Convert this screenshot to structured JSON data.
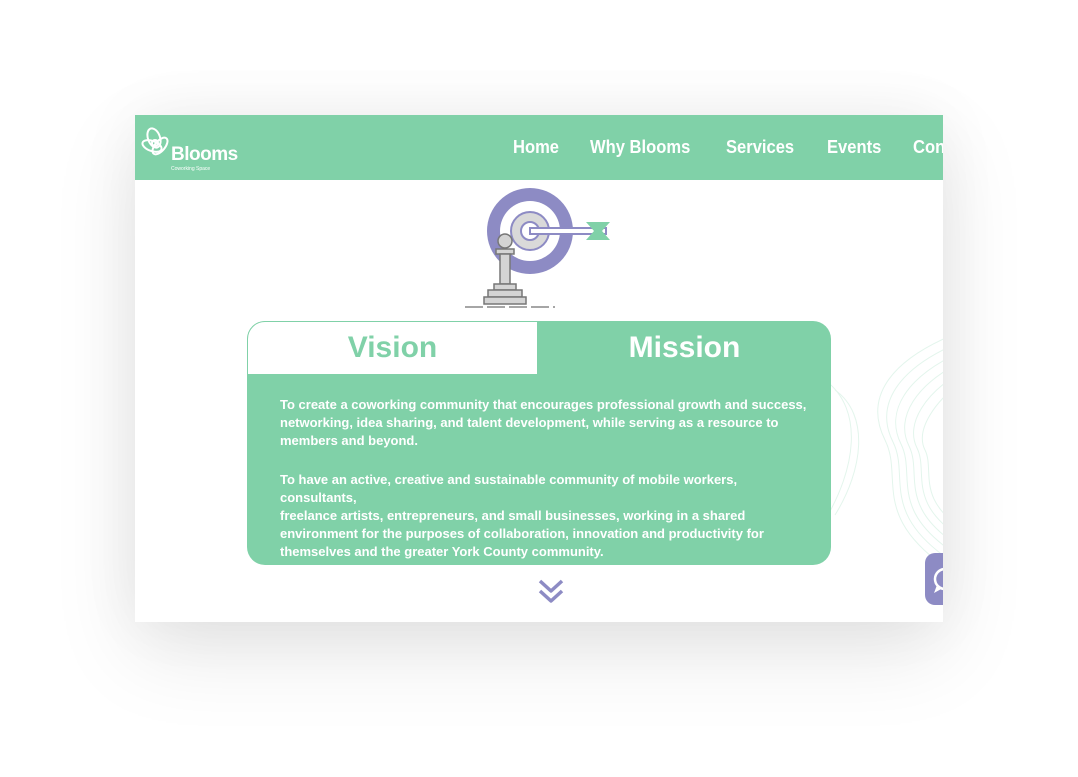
{
  "brand": {
    "name": "Blooms",
    "tagline": "Coworking Space",
    "colors": {
      "primary": "#80d1a8",
      "accent": "#8d8bc4",
      "white": "#ffffff"
    }
  },
  "nav": {
    "items": [
      {
        "label": "Home"
      },
      {
        "label": "Why Blooms"
      },
      {
        "label": "Services"
      },
      {
        "label": "Events"
      },
      {
        "label": "Contact us"
      }
    ]
  },
  "hero": {
    "illustration": "target-arrow-chess-icon"
  },
  "card": {
    "tabs": [
      {
        "label": "Vision",
        "active": false
      },
      {
        "label": "Mission",
        "active": true
      }
    ],
    "paragraphs": [
      "To create a coworking community that encourages professional growth and success,\nnetworking, idea sharing, and talent development, while serving as a resource to\nmembers and beyond.",
      "To have an active, creative and sustainable community of mobile workers, consultants,\nfreelance artists, entrepreneurs, and small businesses, working in a shared\n environment for the purposes of collaboration, innovation and productivity for\n themselves and the greater York County community."
    ]
  },
  "icons": {
    "scroll": "double-chevron-down-icon",
    "chat": "chat-bubble-icon"
  }
}
